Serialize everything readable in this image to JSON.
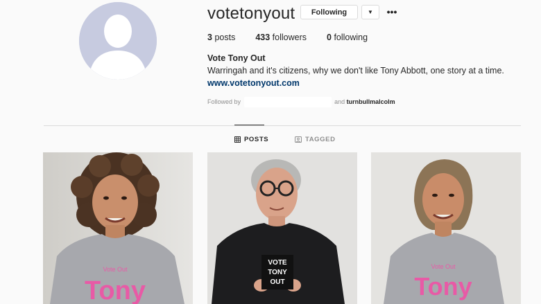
{
  "profile": {
    "username": "votetonyout",
    "following_button": "Following",
    "dropdown_icon": "chevron-down-icon",
    "more_icon": "more-options-icon",
    "more_glyph": "•••",
    "dropdown_glyph": "▼"
  },
  "stats": {
    "posts_count": "3",
    "posts_label": "posts",
    "followers_count": "433",
    "followers_label": "followers",
    "following_count": "0",
    "following_label": "following"
  },
  "bio": {
    "full_name": "Vote Tony Out",
    "text": "Warringah and it's citizens, why we don't like Tony Abbott, one story at a time.",
    "website": "www.votetonyout.com",
    "followed_by_prefix": "Followed by",
    "followed_by_and": "and",
    "followed_by_user": "turnbullmalcolm"
  },
  "tabs": [
    {
      "label": "POSTS",
      "icon": "grid-icon",
      "active": true
    },
    {
      "label": "TAGGED",
      "icon": "tag-icon",
      "active": false
    }
  ],
  "posts": [
    {
      "shirt_text": "Tony",
      "shirt_small": "Vote Out"
    },
    {
      "sign_text": "VOTE TONY OUT"
    },
    {
      "shirt_text": "Tony",
      "shirt_small": "Vote Out"
    }
  ],
  "colors": {
    "link": "#00376b",
    "avatar_bg": "#c7cbe0",
    "shirt_pink": "#e85aa6"
  }
}
